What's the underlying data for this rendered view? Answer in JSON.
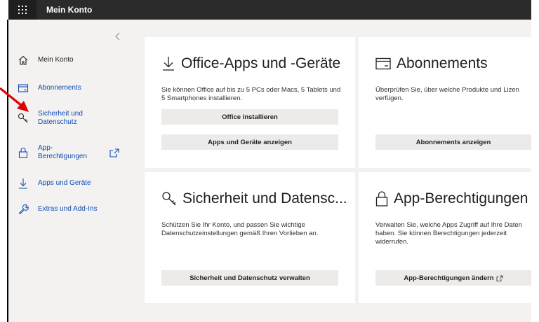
{
  "header": {
    "title": "Mein Konto"
  },
  "sidebar": {
    "items": [
      {
        "label": "Mein Konto"
      },
      {
        "label": "Abonnements"
      },
      {
        "label": "Sicherheit und Datenschutz"
      },
      {
        "label": "App-Berechtigungen"
      },
      {
        "label": "Apps und Geräte"
      },
      {
        "label": "Extras und Add-Ins"
      }
    ]
  },
  "cards": {
    "office": {
      "title": "Office-Apps und -Geräte",
      "desc": "Sie können Office auf bis zu 5 PCs oder Macs, 5 Tablets und 5 Smartphones installieren.",
      "btn1": "Office installieren",
      "btn2": "Apps und Geräte anzeigen"
    },
    "subs": {
      "title": "Abonnements",
      "desc": "Überprüfen Sie, über welche Produkte und Lizen verfügen.",
      "btn": "Abonnements anzeigen"
    },
    "security": {
      "title": "Sicherheit und Datensc...",
      "desc": "Schützen Sie Ihr Konto, und passen Sie wichtige Datenschutzeinstellungen gemäß Ihren Vorlieben an.",
      "btn": "Sicherheit und Datenschutz verwalten"
    },
    "perms": {
      "title": "App-Berechtigungen",
      "desc": "Verwalten Sie, welche Apps Zugriff auf Ihre Daten haben. Sie können Berechtigungen jederzeit widerrufen.",
      "btn": "App-Berechtigungen ändern"
    }
  },
  "colors": {
    "topbar": "#2b2b2b",
    "link": "#0f4cb5",
    "annotation_arrow": "#e00000"
  }
}
